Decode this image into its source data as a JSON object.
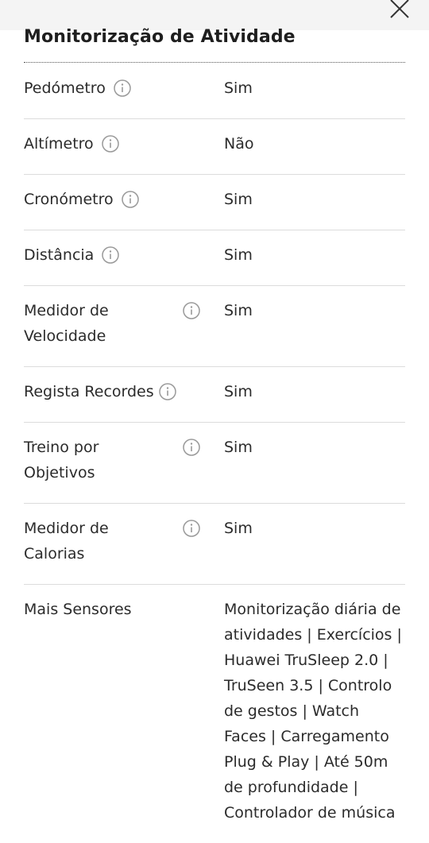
{
  "dialog": {
    "close_icon": "close-x-icon"
  },
  "section": {
    "title": "Monitorização de Atividade"
  },
  "rows": [
    {
      "label": "Pedómetro",
      "info_icon": true,
      "value": "Sim"
    },
    {
      "label": "Altímetro",
      "info_icon": true,
      "value": "Não"
    },
    {
      "label": "Cronómetro",
      "info_icon": true,
      "value": "Sim"
    },
    {
      "label": "Distância",
      "info_icon": true,
      "value": "Sim"
    },
    {
      "label": "Medidor de Velocidade",
      "info_icon": true,
      "value": "Sim"
    },
    {
      "label": "Regista Recordes",
      "info_icon": true,
      "value": "Sim"
    },
    {
      "label": "Treino por Objetivos",
      "info_icon": true,
      "value": "Sim"
    },
    {
      "label": "Medidor de Calorias",
      "info_icon": true,
      "value": "Sim"
    },
    {
      "label": "Mais Sensores",
      "info_icon": false,
      "value": "Monitorização diária de atividades | Exercícios | Huawei TruSleep 2.0 | TruSeen 3.5 | Controlo de gestos | Watch Faces | Carregamento Plug & Play | Até 50m de profundidade | Controlador de música"
    }
  ]
}
